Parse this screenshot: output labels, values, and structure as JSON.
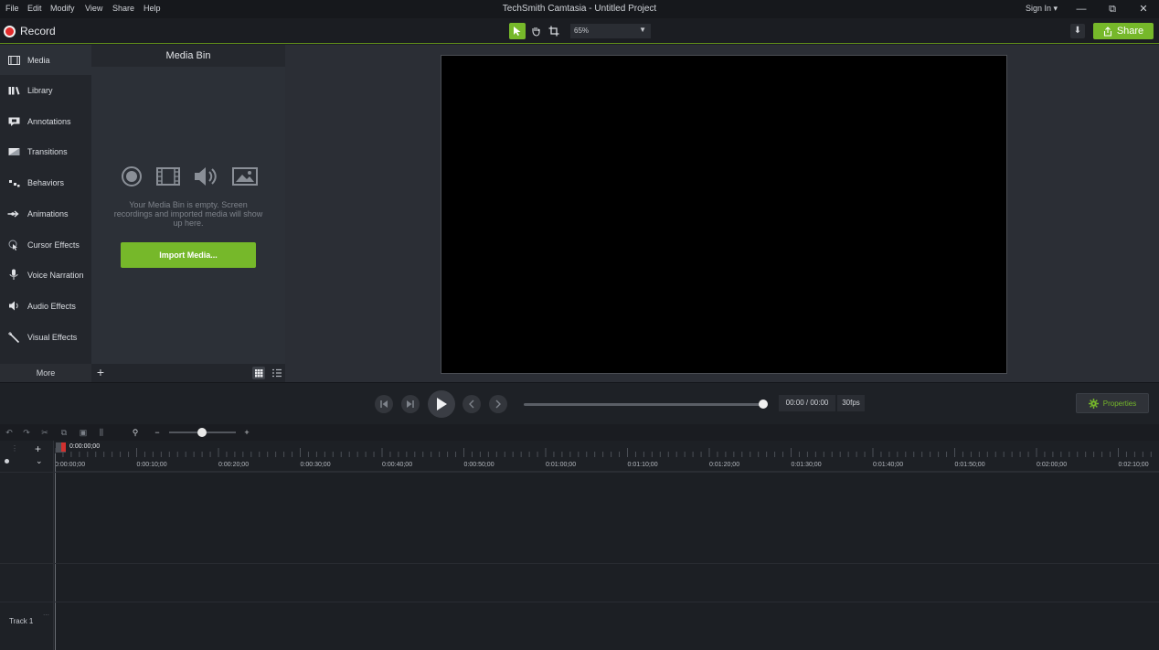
{
  "window": {
    "title": "TechSmith Camtasia - Untitled Project",
    "sign_in": "Sign In ▾",
    "controls": {
      "minimize": "—",
      "restore": "⧉",
      "close": "✕"
    }
  },
  "menu": [
    "File",
    "Edit",
    "Modify",
    "View",
    "Share",
    "Help"
  ],
  "toolbar": {
    "record_label": "Record",
    "zoom_value": "65%",
    "share_label": "Share"
  },
  "nav": {
    "items": [
      {
        "label": "Media",
        "icon": "film-strip-icon"
      },
      {
        "label": "Library",
        "icon": "library-books-icon"
      },
      {
        "label": "Annotations",
        "icon": "annotation-callout-icon"
      },
      {
        "label": "Transitions",
        "icon": "transition-icon"
      },
      {
        "label": "Behaviors",
        "icon": "behaviors-icon"
      },
      {
        "label": "Animations",
        "icon": "animation-arrow-icon"
      },
      {
        "label": "Cursor Effects",
        "icon": "cursor-effects-icon"
      },
      {
        "label": "Voice Narration",
        "icon": "microphone-icon"
      },
      {
        "label": "Audio Effects",
        "icon": "speaker-icon"
      },
      {
        "label": "Visual Effects",
        "icon": "magic-wand-icon"
      }
    ],
    "more_label": "More",
    "add_label": "+"
  },
  "media_bin": {
    "title": "Media Bin",
    "empty_message": "Your Media Bin is empty. Screen recordings and imported media will show up here.",
    "import_label": "Import Media..."
  },
  "playback": {
    "timecode": "00:00 / 00:00",
    "fps": "30fps",
    "properties_label": "Properties",
    "progress": 1.0
  },
  "timeline": {
    "playhead_time": "0:00:00;00",
    "ticks": [
      "0:00:00;00",
      "0:00:10;00",
      "0:00:20;00",
      "0:00:30;00",
      "0:00:40;00",
      "0:00:50;00",
      "0:01:00;00",
      "0:01:10;00",
      "0:01:20;00",
      "0:01:30;00",
      "0:01:40;00",
      "0:01:50;00",
      "0:02:00;00",
      "0:02:10;00"
    ],
    "track_label": "Track 1",
    "zoom_minus": "−",
    "zoom_plus": "+"
  },
  "colors": {
    "accent_green": "#76b82a",
    "record_red": "#e32b2b",
    "canvas_black": "#000000"
  }
}
